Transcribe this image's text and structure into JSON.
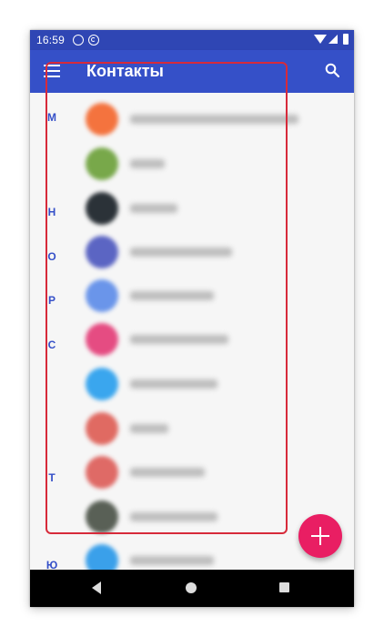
{
  "status_bar": {
    "time": "16:59"
  },
  "app_bar": {
    "title": "Контакты"
  },
  "index_letters": [
    "М",
    "Н",
    "О",
    "Р",
    "С",
    "Т",
    "Ю"
  ],
  "contacts": [
    {
      "avatar_color": "#f4733e"
    },
    {
      "avatar_color": "#78a84a"
    },
    {
      "avatar_color": "#2b3238"
    },
    {
      "avatar_color": "#5b65c3"
    },
    {
      "avatar_color": "#6a95ea"
    },
    {
      "avatar_color": "#e54c82"
    },
    {
      "avatar_color": "#3aa6ee"
    },
    {
      "avatar_color": "#e06a62"
    },
    {
      "avatar_color": "#df6a66"
    },
    {
      "avatar_color": "#596056"
    },
    {
      "avatar_color": "#3aa0ea"
    }
  ],
  "colors": {
    "status_bar": "#2f46b4",
    "app_bar": "#3550c8",
    "accent_letters": "#3550c8",
    "fab": "#e91e63",
    "highlight_frame": "#d72a3a",
    "nav_bar": "#000000"
  },
  "icons": {
    "menu": "hamburger-icon",
    "search": "search-icon",
    "fab": "plus-icon",
    "nav_back": "back-triangle-icon",
    "nav_home": "home-circle-icon",
    "nav_recent": "recents-square-icon"
  }
}
